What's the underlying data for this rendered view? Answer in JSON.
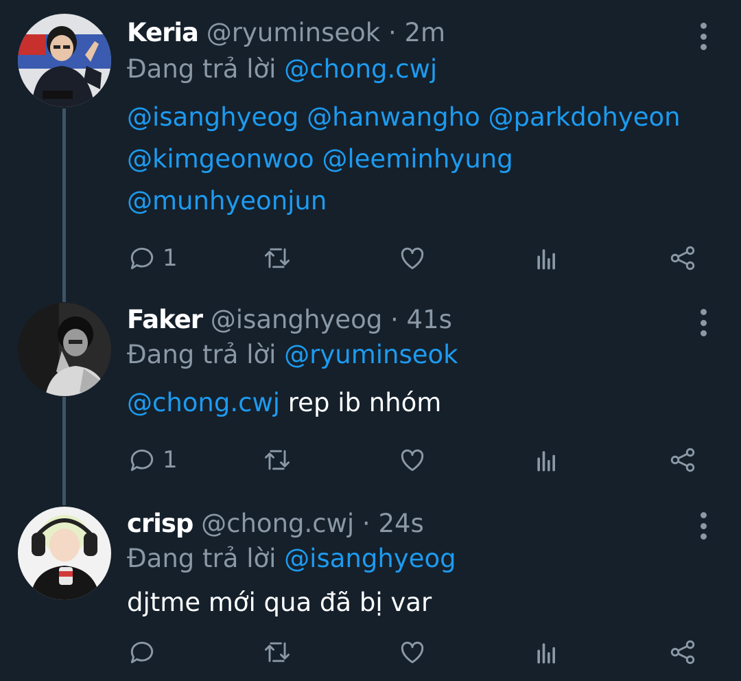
{
  "tweets": [
    {
      "display_name": "Keria",
      "handle": "@ryuminseok",
      "time": "· 2m",
      "reply_prefix": "Đang trả lời",
      "reply_to": "@chong.cwj",
      "body_lines": [
        [
          "@isanghyeog",
          "@hanwangho",
          "@parkdohyeon"
        ],
        [
          "@kimgeonwoo",
          "@leeminhyung"
        ],
        [
          "@munhyeonjun"
        ]
      ],
      "reply_count": "1"
    },
    {
      "display_name": "Faker",
      "handle": "@isanghyeog",
      "time": "· 41s",
      "reply_prefix": "Đang trả lời",
      "reply_to": "@ryuminseok",
      "body_mention": "@chong.cwj",
      "body_text": "rep ib nhóm",
      "reply_count": "1"
    },
    {
      "display_name": "crisp",
      "handle": "@chong.cwj",
      "time": "· 24s",
      "reply_prefix": "Đang trả lời",
      "reply_to": "@isanghyeog",
      "body_text": "djtme mới qua đã bị var",
      "reply_count": ""
    }
  ],
  "icons": [
    "reply-icon",
    "retweet-icon",
    "like-icon",
    "analytics-icon",
    "share-icon",
    "more-icon"
  ],
  "colors": {
    "background": "#15202b",
    "mention": "#1d9bf0",
    "muted": "#8b98a5",
    "text": "#ffffff",
    "thread_line": "#3d5466"
  }
}
